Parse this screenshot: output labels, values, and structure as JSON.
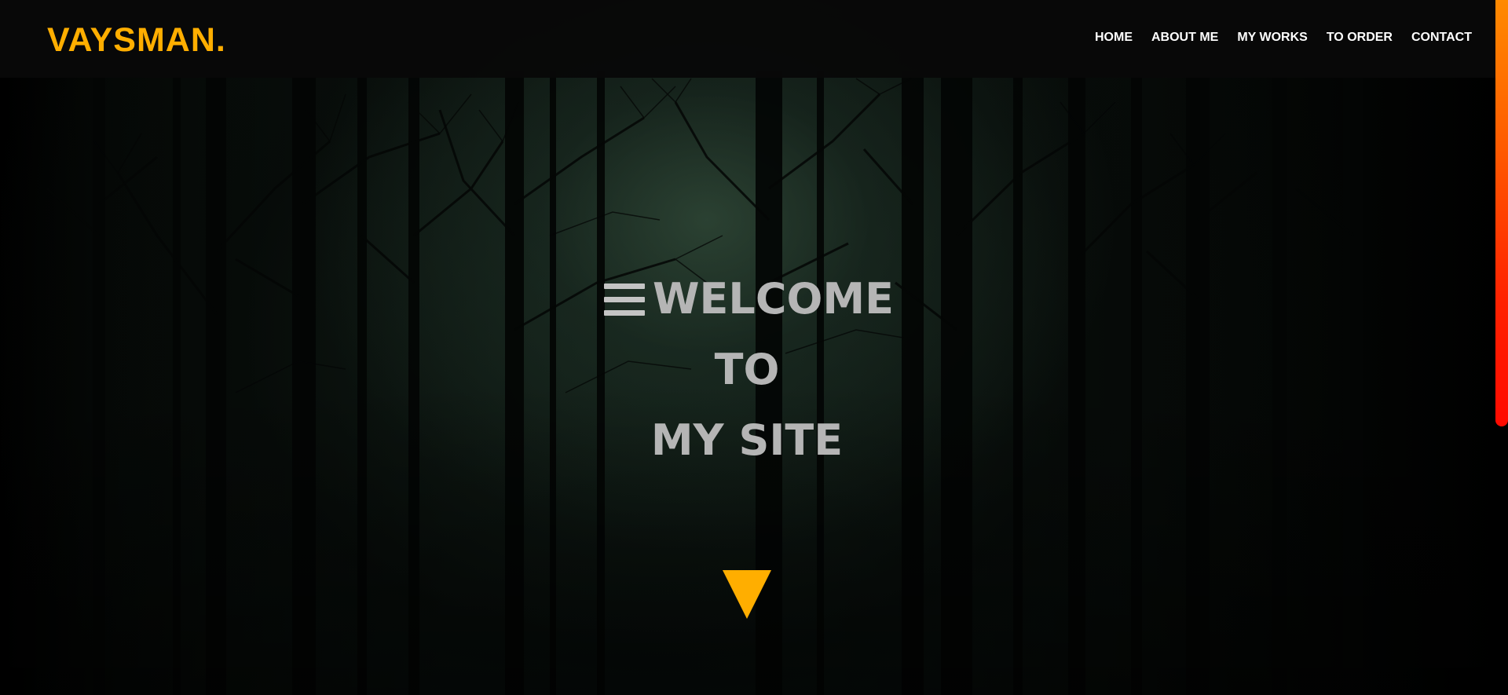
{
  "header": {
    "logo": "VAYSMAN.",
    "nav": [
      {
        "label": "HOME"
      },
      {
        "label": "ABOUT ME"
      },
      {
        "label": "MY WORKS"
      },
      {
        "label": "TO ORDER"
      },
      {
        "label": "CONTACT"
      }
    ]
  },
  "hero": {
    "title_lines": [
      "WELCOME",
      "TO",
      "MY SITE"
    ],
    "menu_icon": "hamburger-menu-icon",
    "scroll_icon": "triangle-down-icon"
  },
  "colors": {
    "accent": "#ffae00",
    "header_bg": "#080808",
    "title_text": "#b5b5b5",
    "nav_text": "#ffffff",
    "scrollbar_top": "#ff8a00",
    "scrollbar_bottom": "#ff0a00"
  }
}
